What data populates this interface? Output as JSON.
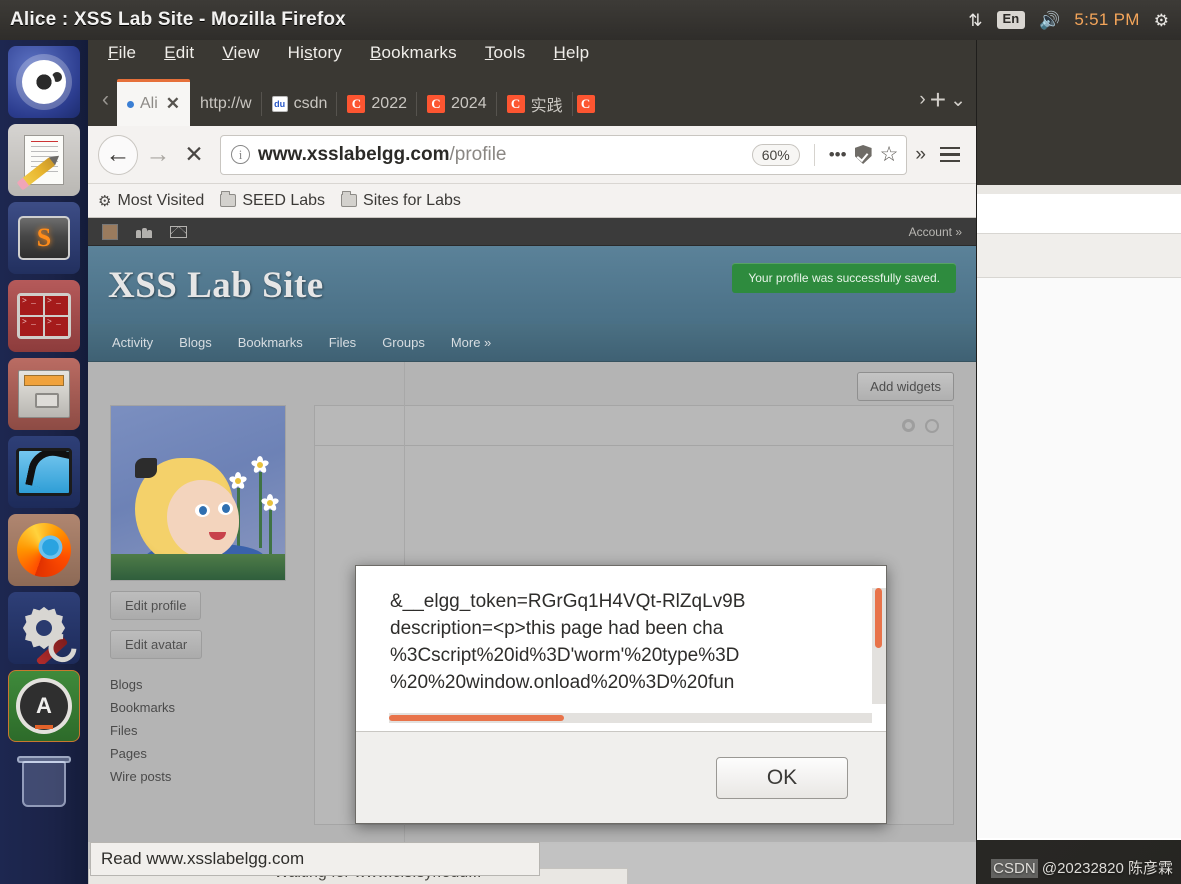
{
  "window": {
    "title": "Alice : XSS Lab Site - Mozilla Firefox"
  },
  "top_panel": {
    "network_icon": "network-up-down-icon",
    "keyboard_layout": "En",
    "volume_icon": "volume-icon",
    "clock": "5:51 PM",
    "gear_icon": "gear-icon"
  },
  "launcher": {
    "items": [
      {
        "name": "ubuntu-dash",
        "label": "Ubuntu Dash"
      },
      {
        "name": "text-editor",
        "label": "Text Editor"
      },
      {
        "name": "sublime-text",
        "label": "Sublime Text"
      },
      {
        "name": "terminal",
        "label": "Terminal"
      },
      {
        "name": "files",
        "label": "Files"
      },
      {
        "name": "wireshark",
        "label": "Wireshark"
      },
      {
        "name": "firefox",
        "label": "Firefox"
      },
      {
        "name": "settings",
        "label": "System Settings"
      },
      {
        "name": "software-updater",
        "label": "Software Updater"
      },
      {
        "name": "trash",
        "label": "Trash"
      }
    ]
  },
  "browser": {
    "menu": [
      {
        "label": "File",
        "accel": "F"
      },
      {
        "label": "Edit",
        "accel": "E"
      },
      {
        "label": "View",
        "accel": "V"
      },
      {
        "label": "History",
        "accel": "s"
      },
      {
        "label": "Bookmarks",
        "accel": "B"
      },
      {
        "label": "Tools",
        "accel": "T"
      },
      {
        "label": "Help",
        "accel": "H"
      }
    ],
    "tabs": [
      {
        "label": "Ali",
        "favicon": "loading-dot",
        "active": true,
        "closeable": true
      },
      {
        "label": "http://w",
        "favicon": "none",
        "active": false
      },
      {
        "label": "csdn",
        "favicon": "baidu-favicon",
        "active": false
      },
      {
        "label": "2022",
        "favicon": "csdn-favicon",
        "active": false
      },
      {
        "label": "2024",
        "favicon": "csdn-favicon",
        "active": false
      },
      {
        "label": "实践",
        "favicon": "csdn-favicon",
        "active": false
      },
      {
        "label": "",
        "favicon": "csdn-favicon",
        "active": false
      }
    ],
    "tab_scroll_left": "‹",
    "tab_scroll_right": "›",
    "new_tab": "+",
    "list_all_tabs": "⌄",
    "nav": {
      "back": "←",
      "forward": "→",
      "stop": "✕",
      "identity_icon": "info-icon",
      "url_domain": "www.xsslabelgg.com",
      "url_path": "/profile",
      "url_full": "www.xsslabelgg.com/profile",
      "zoom_level": "60%",
      "page_actions": "•••",
      "tracking_protection": "shield-icon",
      "bookmark_star": "☆",
      "overflow": "»",
      "menu": "hamburger-icon"
    },
    "bookmarks": [
      {
        "label": "Most Visited",
        "icon": "gear-icon"
      },
      {
        "label": "SEED Labs",
        "icon": "folder-icon"
      },
      {
        "label": "Sites for Labs",
        "icon": "folder-icon"
      }
    ]
  },
  "page": {
    "topbar": {
      "avatar_icon": "avatar-thumbnail-icon",
      "friends_icon": "friends-icon",
      "mail_icon": "mail-icon",
      "account": "Account »"
    },
    "site_title": "XSS Lab Site",
    "toast": "Your profile was successfully saved.",
    "nav": [
      "Activity",
      "Blogs",
      "Bookmarks",
      "Files",
      "Groups",
      "More »"
    ],
    "add_widgets": "Add widgets",
    "sidebar_buttons": [
      "Edit profile",
      "Edit avatar"
    ],
    "sidebar_links": [
      "Blogs",
      "Bookmarks",
      "Files",
      "Pages",
      "Wire posts"
    ],
    "widget_gear_icon": "widget-settings-icon",
    "widget_close_icon": "widget-close-icon",
    "avatar_alt": "Alice avatar"
  },
  "dialog": {
    "lines": [
      "&__elgg_token=RGrGq1H4VQt-RlZqLv9B",
      "description=<p>this page had been cha",
      "%3Cscript%20id%3D'worm'%20type%3D",
      "%20%20window.onload%20%3D%20fun"
    ],
    "ok_label": "OK",
    "scroll_accent": "#e8734a"
  },
  "status": {
    "message": "Read www.xsslabelgg.com",
    "behind_message": "Waiting for www.cis.syr.edu..."
  },
  "watermark": {
    "text": "CSDN @20232820 陈彦霖",
    "prefix": "CSDN"
  },
  "colors": {
    "panel_bg": "#3a3833",
    "launcher_bg": "#1d2750",
    "accent_orange": "#e6703a",
    "elgg_header": "#4a7086",
    "toast_green": "#2e8b3e",
    "clock_orange": "#f4a55a"
  }
}
